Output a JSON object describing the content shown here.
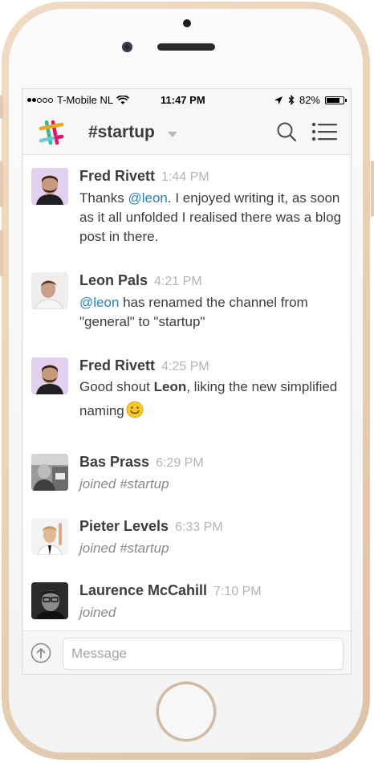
{
  "status_bar": {
    "carrier": "T-Mobile NL",
    "time": "11:47 PM",
    "battery": "82%",
    "battery_level": 0.82,
    "signal_dots_filled": 2,
    "signal_dots_total": 5
  },
  "header": {
    "channel": "#startup",
    "icons": [
      "slack-logo-icon",
      "search-icon",
      "channel-list-icon"
    ]
  },
  "messages": [
    {
      "author": "Fred Rivett",
      "time": "1:44 PM",
      "parts": [
        "Thanks ",
        "@leon",
        ". I enjoyed writing it, as soon as it all unfolded I realised there was a blog post in there."
      ]
    },
    {
      "author": "Leon Pals",
      "time": "4:21 PM",
      "parts": [
        "@leon",
        " has renamed the channel from \"general\" to \"startup\""
      ]
    },
    {
      "author": "Fred Rivett",
      "time": "4:25 PM",
      "parts": [
        "Good shout ",
        "Leon",
        ", liking the new simplified naming"
      ]
    },
    {
      "author": "Bas Prass",
      "time": "6:29 PM",
      "text": "joined #startup"
    },
    {
      "author": "Pieter Levels",
      "time": "6:33 PM",
      "text": "joined #startup"
    },
    {
      "author": "Laurence McCahill",
      "time": "7:10 PM",
      "text": "joined"
    }
  ],
  "composer": {
    "placeholder": "Message"
  },
  "colors": {
    "mention": "#2a80b9",
    "text": "#3d3d3d",
    "timestamp": "#b4b4b4",
    "phone_frame": "#e9d2b8"
  }
}
